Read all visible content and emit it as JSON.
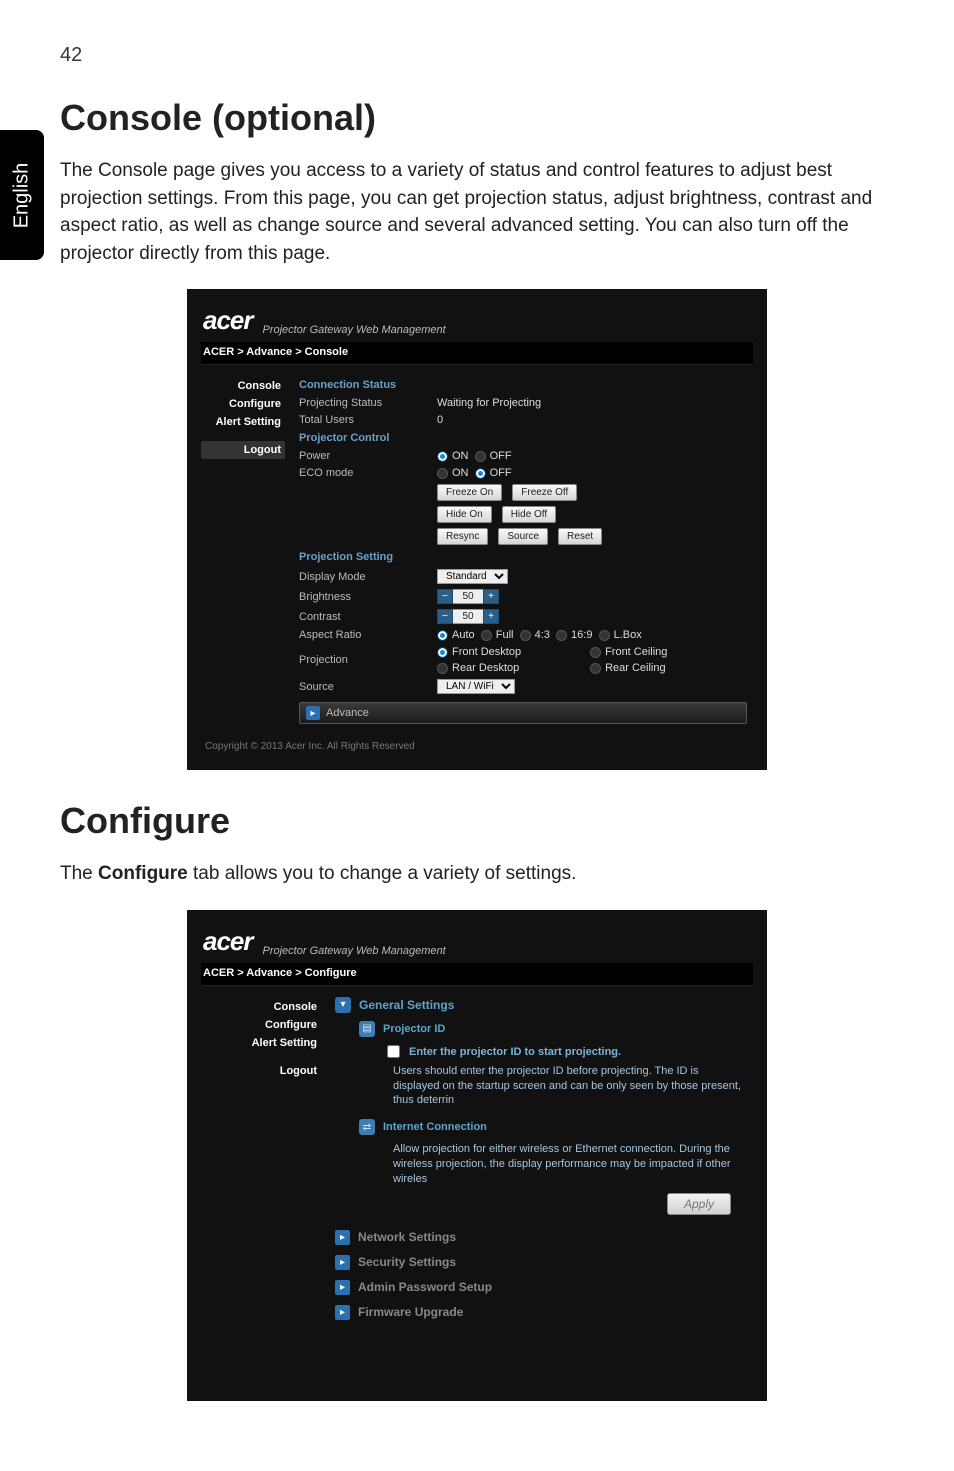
{
  "page_number": "42",
  "language_label": "English",
  "section1": {
    "title": "Console (optional)",
    "body": "The Console page gives you access to a variety of status and control features to adjust best projection settings. From this page, you can get projection status, adjust brightness, contrast and aspect ratio, as well as change source and several advanced setting. You can also turn off the projector directly from this page."
  },
  "section2": {
    "title": "Configure",
    "body_prefix": "The ",
    "body_bold": "Configure",
    "body_suffix": " tab allows you to change a variety of settings."
  },
  "console_shot": {
    "logo": "acer",
    "logo_sub": "Projector Gateway Web Management",
    "crumb": "ACER > Advance > Console",
    "nav": {
      "console": "Console",
      "configure": "Configure",
      "alert": "Alert Setting",
      "logout": "Logout"
    },
    "groups": {
      "conn": {
        "title": "Connection Status",
        "projecting_status_k": "Projecting Status",
        "projecting_status_v": "Waiting for Projecting",
        "total_users_k": "Total Users",
        "total_users_v": "0"
      },
      "control": {
        "title": "Projector Control",
        "power_k": "Power",
        "eco_k": "ECO mode",
        "on_label": "ON",
        "off_label": "OFF",
        "freeze_on": "Freeze On",
        "freeze_off": "Freeze Off",
        "hide_on": "Hide On",
        "hide_off": "Hide Off",
        "resync": "Resync",
        "source_btn": "Source",
        "reset": "Reset"
      },
      "proj": {
        "title": "Projection Setting",
        "display_mode_k": "Display Mode",
        "display_mode_v": "Standard",
        "brightness_k": "Brightness",
        "brightness_v": "50",
        "contrast_k": "Contrast",
        "contrast_v": "50",
        "aspect_k": "Aspect Ratio",
        "aspect_opts": {
          "auto": "Auto",
          "full": "Full",
          "r43": "4:3",
          "r169": "16:9",
          "lbox": "L.Box"
        },
        "projection_k": "Projection",
        "projection_opts": {
          "fd": "Front Desktop",
          "fc": "Front Ceiling",
          "rd": "Rear Desktop",
          "rc": "Rear Ceiling"
        },
        "source_k": "Source",
        "source_v": "LAN / WiFi"
      },
      "advance": "Advance"
    },
    "footer": "Copyright © 2013 Acer Inc. All Rights Reserved"
  },
  "configure_shot": {
    "logo": "acer",
    "logo_sub": "Projector Gateway Web Management",
    "crumb": "ACER > Advance > Configure",
    "nav": {
      "console": "Console",
      "configure": "Configure",
      "alert": "Alert Setting",
      "logout": "Logout"
    },
    "general_settings": "General Settings",
    "projector_id": "Projector ID",
    "projector_id_sub": "Enter the projector ID to start projecting.",
    "projector_id_body": "Users should enter the projector ID before projecting. The ID is displayed on the startup screen and can be only seen by those present, thus deterrin",
    "internet_conn": "Internet Connection",
    "internet_conn_body": "Allow projection for either wireless or Ethernet connection. During the wireless projection, the display performance may be impacted if other wireles",
    "apply": "Apply",
    "network_settings": "Network Settings",
    "security_settings": "Security Settings",
    "admin_pw": "Admin Password Setup",
    "firmware": "Firmware Upgrade"
  }
}
